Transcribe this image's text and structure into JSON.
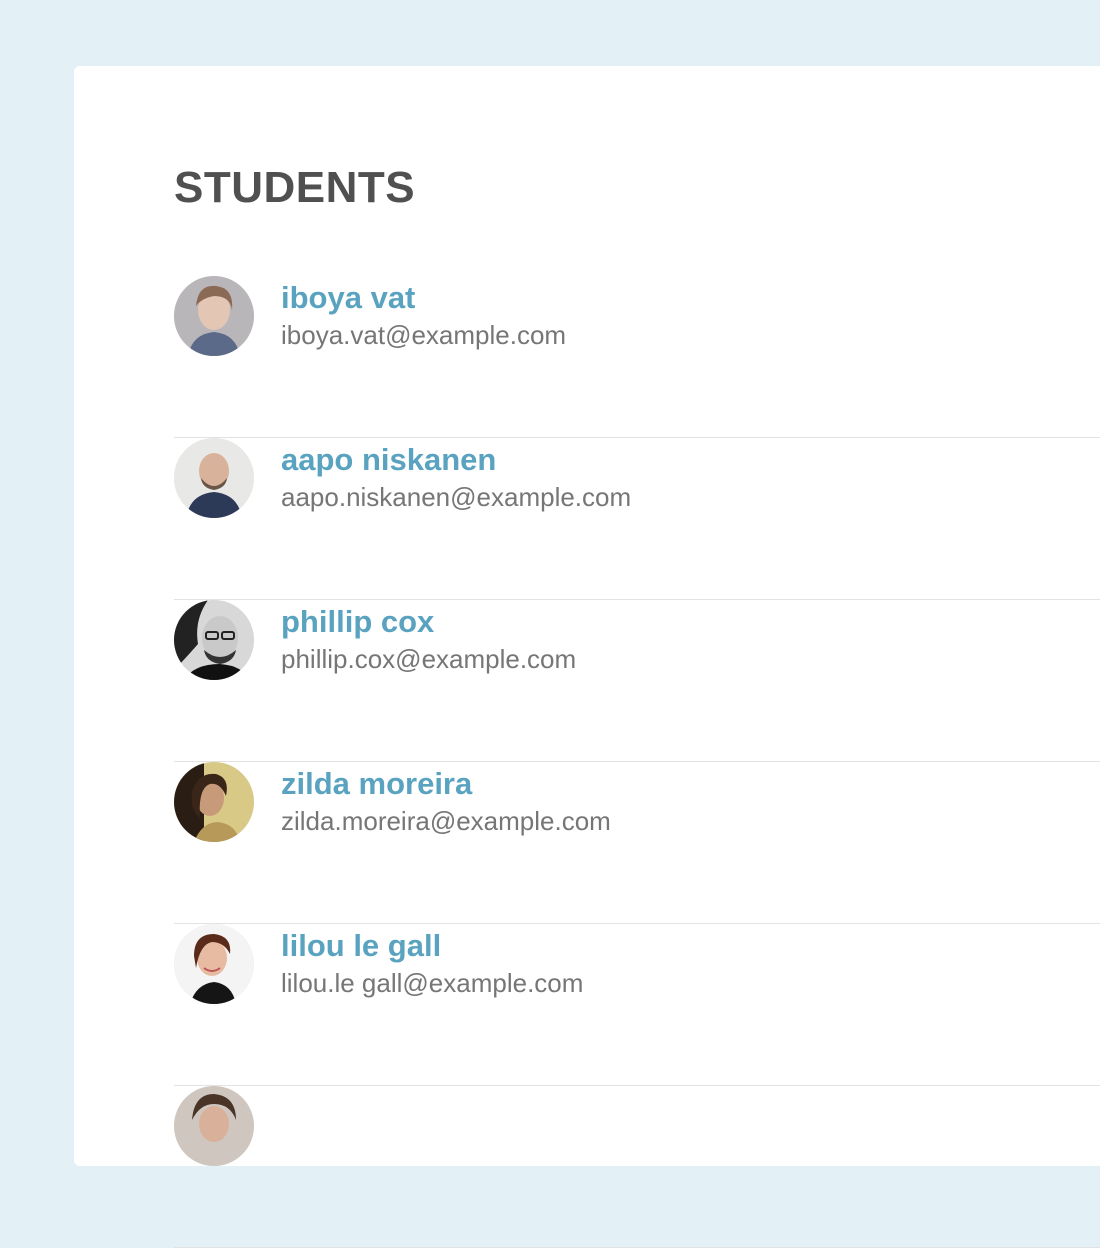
{
  "heading": "STUDENTS",
  "colors": {
    "background": "#e3f0f5",
    "card": "#ffffff",
    "heading": "#505050",
    "name_link": "#5aa3c0",
    "email": "#767676",
    "divider": "#e2e2e2"
  },
  "students": [
    {
      "name": "iboya vat",
      "email": "iboya.vat@example.com",
      "avatar": "avatar-photo-woman"
    },
    {
      "name": "aapo niskanen",
      "email": "aapo.niskanen@example.com",
      "avatar": "avatar-photo-man"
    },
    {
      "name": "phillip cox",
      "email": "phillip.cox@example.com",
      "avatar": "avatar-photo-man"
    },
    {
      "name": "zilda moreira",
      "email": "zilda.moreira@example.com",
      "avatar": "avatar-photo-woman"
    },
    {
      "name": "lilou le gall",
      "email": "lilou.le gall@example.com",
      "avatar": "avatar-photo-woman"
    },
    {
      "name": "",
      "email": "",
      "avatar": "avatar-photo-woman"
    }
  ]
}
